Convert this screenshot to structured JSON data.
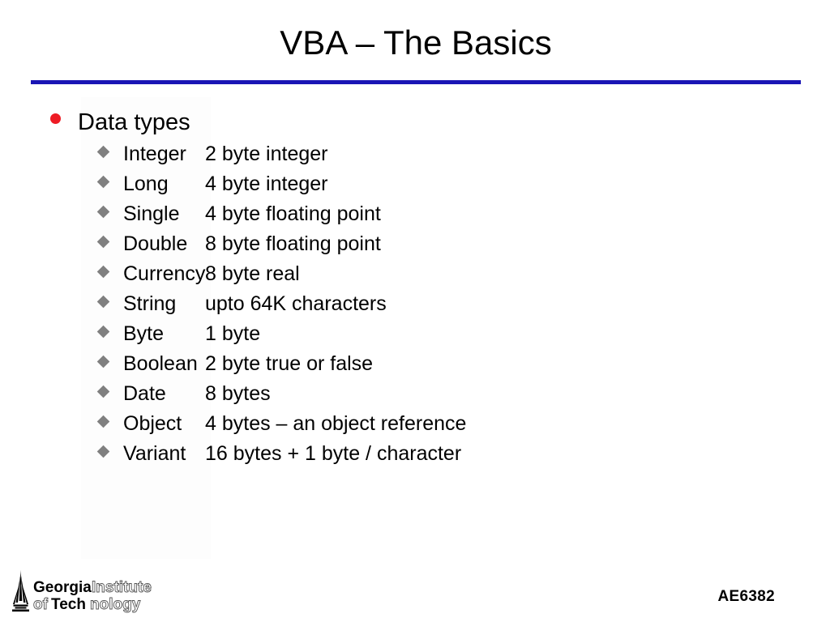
{
  "slide": {
    "title": "VBA – The Basics",
    "rule_color": "#1a15b5",
    "background_color": "#ffffff"
  },
  "body": {
    "level1_bullet": {
      "label": "Data types",
      "bullet_icon": "red-dot-bullet-icon",
      "bullet_color": "#ee1b24"
    },
    "sub_bullet_icon": "gray-diamond-bullet-icon",
    "sub_bullet_color": "#808080",
    "rows": [
      {
        "name": "Integer",
        "desc": "2 byte integer"
      },
      {
        "name": "Long",
        "desc": "4 byte integer"
      },
      {
        "name": "Single",
        "desc": "4 byte floating point"
      },
      {
        "name": "Double",
        "desc": "8 byte floating point"
      },
      {
        "name": "Currency",
        "desc": "8 byte real"
      },
      {
        "name": "String",
        "desc": "upto 64K characters"
      },
      {
        "name": "Byte",
        "desc": "1 byte"
      },
      {
        "name": "Boolean",
        "desc": "2 byte true or false"
      },
      {
        "name": "Date",
        "desc": "8 bytes"
      },
      {
        "name": "Object",
        "desc": "4 bytes – an object reference"
      },
      {
        "name": "Variant",
        "desc": "16 bytes + 1 byte / character"
      }
    ]
  },
  "footer": {
    "logo": {
      "icon": "georgia-tech-tower-icon",
      "line1_solid": "Georgia",
      "line1_outline": "Institute",
      "line2_outline_prefix": "of",
      "line2_solid": "Tech",
      "line2_outline_suffix": "nology"
    },
    "course_code": "AE6382"
  }
}
